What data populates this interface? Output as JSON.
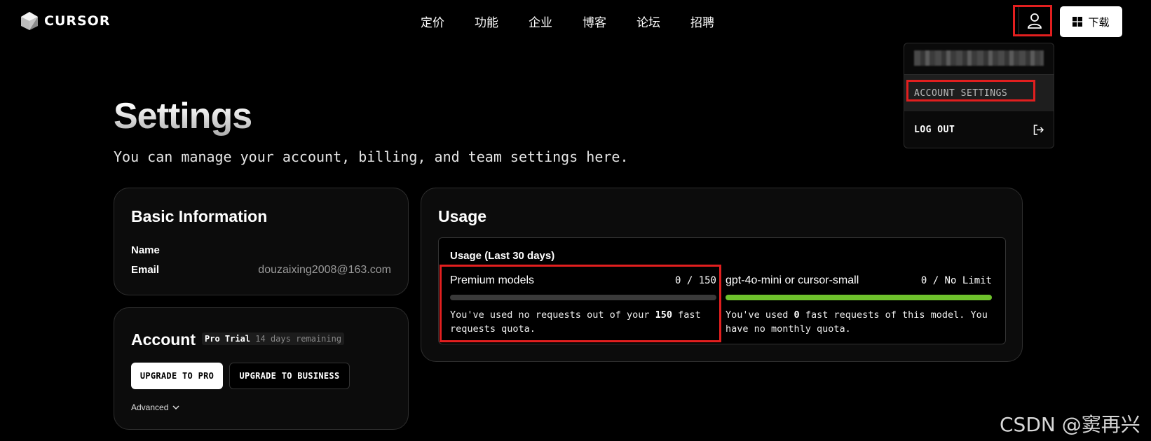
{
  "brand": {
    "name": "CURSOR"
  },
  "nav": [
    "定价",
    "功能",
    "企业",
    "博客",
    "论坛",
    "招聘"
  ],
  "header": {
    "download_label": "下载"
  },
  "dropdown": {
    "account_settings": "ACCOUNT SETTINGS",
    "log_out": "LOG OUT"
  },
  "page": {
    "title": "Settings",
    "subtitle": "You can manage your account, billing, and team settings here."
  },
  "basic": {
    "title": "Basic Information",
    "name_label": "Name",
    "name_value": "",
    "email_label": "Email",
    "email_value": "douzaixing2008@163.com"
  },
  "account": {
    "title": "Account",
    "plan": "Pro Trial",
    "remaining": "14 days remaining",
    "upgrade_pro": "UPGRADE TO PRO",
    "upgrade_business": "UPGRADE TO BUSINESS",
    "advanced": "Advanced"
  },
  "usage": {
    "title": "Usage",
    "box_title": "Usage (Last 30 days)",
    "premium": {
      "name": "Premium models",
      "count": "0 / 150",
      "progress": 0,
      "desc_prefix": "You've used no requests out of your ",
      "desc_bold": "150",
      "desc_suffix": " fast requests quota."
    },
    "small": {
      "name": "gpt-4o-mini or cursor-small",
      "count": "0 / No Limit",
      "progress": 1,
      "desc_prefix": "You've used ",
      "desc_bold": "0",
      "desc_suffix": " fast requests of this model. You have no monthly quota."
    }
  },
  "watermark": "CSDN @窦再兴",
  "colors": {
    "highlight": "#e21f1f",
    "progress_green": "#6ec22c"
  },
  "icons": [
    "cursor-logo-icon",
    "user-icon",
    "windows-icon",
    "logout-icon",
    "chevron-down-icon"
  ]
}
